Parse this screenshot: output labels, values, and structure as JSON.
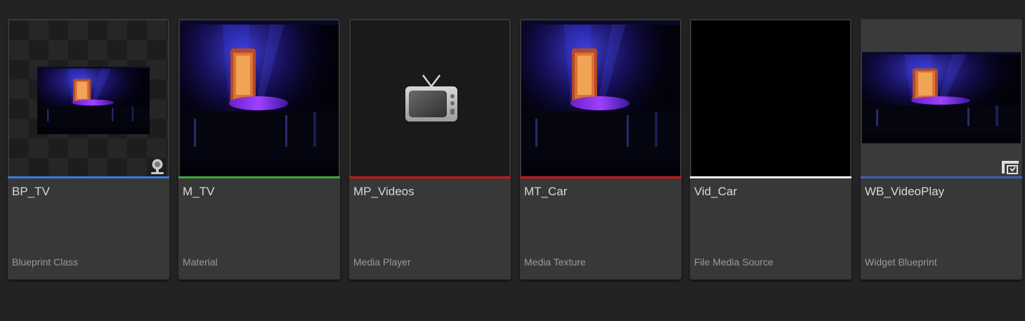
{
  "colors": {
    "blueprint": "#3d7ad6",
    "material": "#3fa83a",
    "media": "#d11414",
    "source": "#f2f2f2",
    "widget": "#3a62b8"
  },
  "assets": [
    {
      "name": "BP_TV",
      "type": "Blueprint Class",
      "icon": "camera-icon"
    },
    {
      "name": "M_TV",
      "type": "Material"
    },
    {
      "name": "MP_Videos",
      "type": "Media Player",
      "icon": "tv-icon"
    },
    {
      "name": "MT_Car",
      "type": "Media Texture"
    },
    {
      "name": "Vid_Car",
      "type": "File Media Source"
    },
    {
      "name": "WB_VideoPlay",
      "type": "Widget Blueprint",
      "icon": "widget-icon"
    }
  ]
}
